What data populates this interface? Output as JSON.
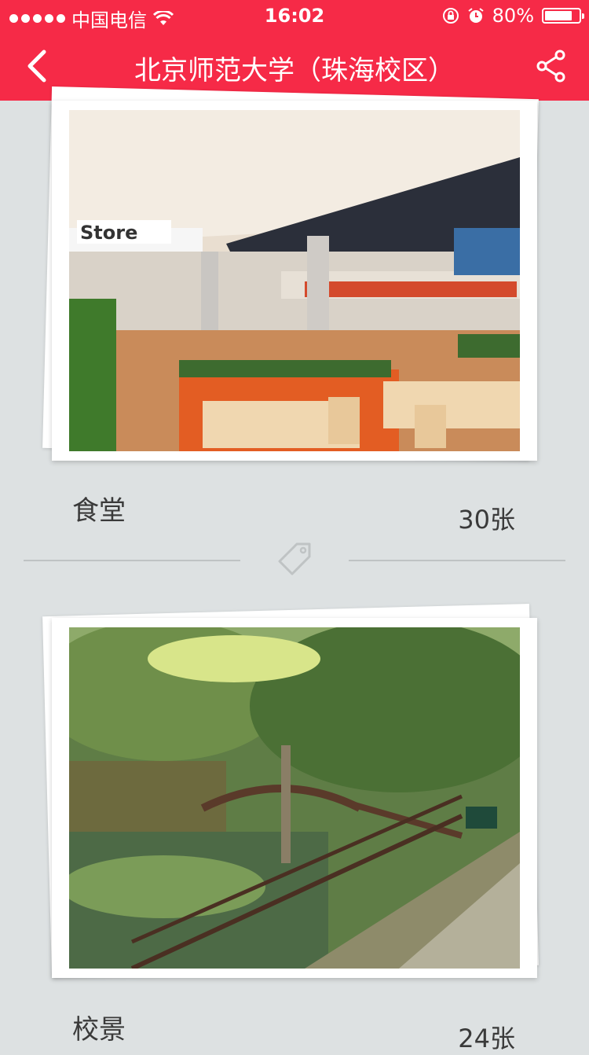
{
  "status_bar": {
    "carrier": "中国电信",
    "time": "16:02",
    "battery_text": "80%",
    "battery_level": 0.8
  },
  "nav": {
    "title": "北京师范大学（珠海校区）",
    "back_icon": "chevron-left-icon",
    "share_icon": "share-icon"
  },
  "albums": [
    {
      "name": "食堂",
      "count": "30张"
    },
    {
      "name": "校景",
      "count": "24张"
    }
  ],
  "colors": {
    "accent": "#f62a47",
    "background": "#dde1e2"
  }
}
